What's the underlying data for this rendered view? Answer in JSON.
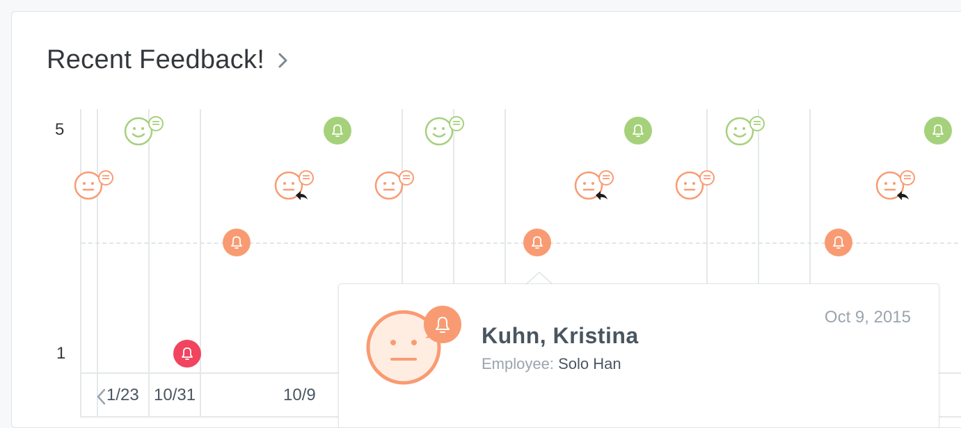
{
  "header": {
    "title": "Recent Feedback!",
    "chevron_icon": "chevron-right-icon"
  },
  "y_axis": {
    "top_label": "5",
    "bottom_label": "1"
  },
  "x_axis": {
    "labels": [
      "1/23",
      "10/31",
      "10/9"
    ],
    "prev_icon": "chevron-left-icon"
  },
  "colors": {
    "positive": "#a5d17b",
    "neutral": "#f99b72",
    "negative": "#f0445f",
    "neutral_light": "#ffede2"
  },
  "markers": [
    {
      "type": "bell",
      "color": "negative",
      "rating": 1
    },
    {
      "type": "bell",
      "color": "neutral",
      "rating": 3
    },
    {
      "type": "bell",
      "color": "neutral",
      "rating": 3
    },
    {
      "type": "bell",
      "color": "neutral",
      "rating": 3
    },
    {
      "type": "bell",
      "color": "positive",
      "rating": 5
    },
    {
      "type": "bell",
      "color": "positive",
      "rating": 5
    },
    {
      "type": "bell",
      "color": "positive",
      "rating": 5
    },
    {
      "type": "smile-comment",
      "color": "positive",
      "rating": 5
    },
    {
      "type": "smile-comment",
      "color": "positive",
      "rating": 5
    },
    {
      "type": "smile-comment",
      "color": "positive",
      "rating": 5
    },
    {
      "type": "neutral-comment",
      "color": "neutral",
      "rating": 4
    },
    {
      "type": "neutral-comment",
      "color": "neutral",
      "rating": 4
    },
    {
      "type": "neutral-comment",
      "color": "neutral",
      "rating": 4
    },
    {
      "type": "neutral-comment-reply",
      "color": "neutral",
      "rating": 4
    },
    {
      "type": "neutral-comment-reply",
      "color": "neutral",
      "rating": 4
    },
    {
      "type": "neutral-comment-reply",
      "color": "neutral",
      "rating": 4
    }
  ],
  "popover": {
    "date": "Oct 9, 2015",
    "name": "Kuhn, Kristina",
    "employee_label": "Employee:",
    "employee_value": "Solo Han",
    "face_icon": "neutral-face-bell-icon"
  }
}
